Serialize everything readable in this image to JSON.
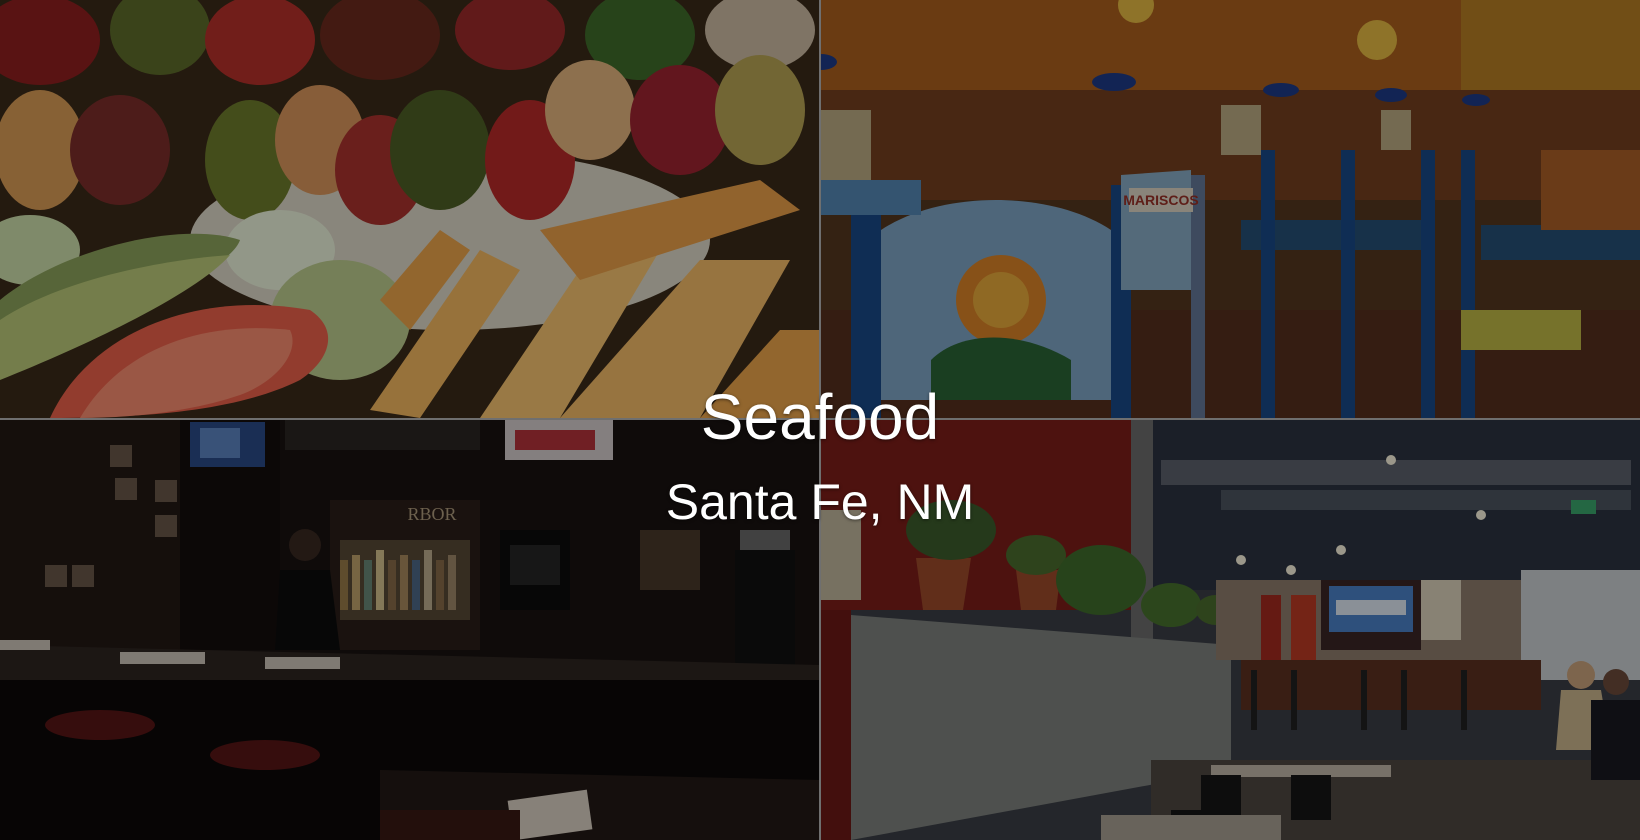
{
  "overlay": {
    "title": "Seafood",
    "subtitle": "Santa Fe, NM"
  },
  "photos": [
    {
      "name": "food-plate-photo",
      "subject": "seafood skewer plate with shrimp, vegetables, potatoes and salad"
    },
    {
      "name": "dining-room-photo",
      "subject": "dining room with painted blue chairs"
    },
    {
      "name": "bar-photo",
      "subject": "dark bar counter with bottles and TV"
    },
    {
      "name": "restaurant-interior-photo",
      "subject": "restaurant interior with red walls and planters"
    }
  ],
  "embedded_text": {
    "chair_sign": "MARISCOS",
    "bar_sign": "RBOR"
  }
}
